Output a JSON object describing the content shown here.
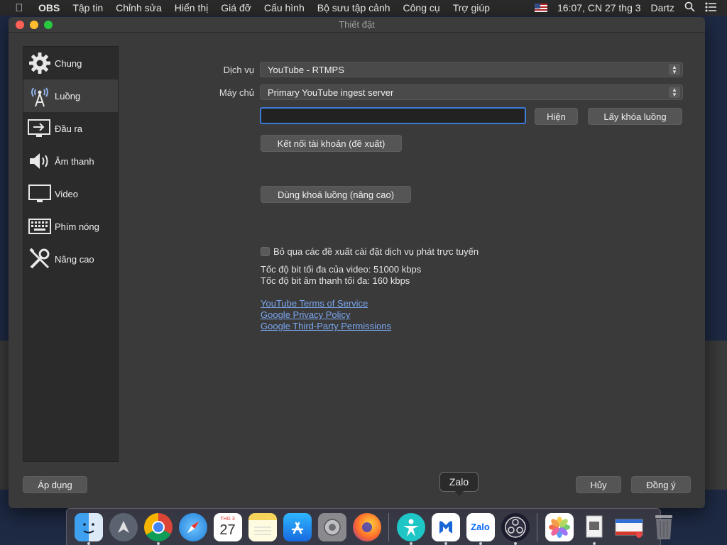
{
  "menubar": {
    "app": "OBS",
    "items": [
      "Tập tin",
      "Chỉnh sửa",
      "Hiển thị",
      "Giá đỡ",
      "Cấu hình",
      "Bộ sưu tập cảnh",
      "Công cụ",
      "Trợ giúp"
    ],
    "clock": "16:07, CN 27 thg 3",
    "user": "Dartz"
  },
  "window": {
    "title": "Thiết đặt"
  },
  "sidebar": {
    "items": [
      {
        "label": "Chung",
        "icon": "gear-icon"
      },
      {
        "label": "Luồng",
        "icon": "antenna-icon"
      },
      {
        "label": "Đầu ra",
        "icon": "output-icon"
      },
      {
        "label": "Âm thanh",
        "icon": "speaker-icon"
      },
      {
        "label": "Video",
        "icon": "monitor-icon"
      },
      {
        "label": "Phím nóng",
        "icon": "keyboard-icon"
      },
      {
        "label": "Nâng cao",
        "icon": "tools-icon"
      }
    ],
    "active_index": 1
  },
  "stream": {
    "service_label": "Dịch vụ",
    "service_value": "YouTube - RTMPS",
    "server_label": "Máy chủ",
    "server_value": "Primary YouTube ingest server",
    "stream_key_value": "",
    "show_button": "Hiện",
    "get_key_button": "Lấy khóa luồng",
    "connect_button": "Kết nối tài khoản (đề xuất)",
    "use_key_button": "Dùng khoá luồng (nâng cao)",
    "ignore_checkbox_label": "Bỏ qua các đề xuất cài đặt dịch vụ phát trực tuyến",
    "ignore_checked": false,
    "max_video_bitrate": "Tốc độ bit tối đa của video: 51000 kbps",
    "max_audio_bitrate": "Tốc độ bit âm thanh tối đa: 160 kbps",
    "links": [
      "YouTube Terms of Service",
      "Google Privacy Policy",
      "Google Third-Party Permissions"
    ]
  },
  "footer": {
    "apply_button": "Áp dụng",
    "cancel_button": "Hủy",
    "ok_button": "Đồng ý"
  },
  "dock": {
    "tooltip": "Zalo",
    "calendar_month": "THG 3",
    "calendar_day": "27",
    "zalo_label": "Zalo",
    "apps": [
      "finder-icon",
      "launchpad-icon",
      "chrome-icon",
      "safari-icon",
      "calendar-icon",
      "notes-icon",
      "app-store-icon",
      "system-preferences-icon",
      "firefox-icon",
      "teamviewer-icon",
      "malwarebytes-icon",
      "zalo-icon",
      "obs-icon",
      "photos-icon",
      "preview-icon",
      "mail-icon",
      "trash-icon"
    ]
  },
  "colors": {
    "accent": "#3e7bd6",
    "link": "#7aa7f0",
    "window_bg": "#3a3a3a"
  }
}
